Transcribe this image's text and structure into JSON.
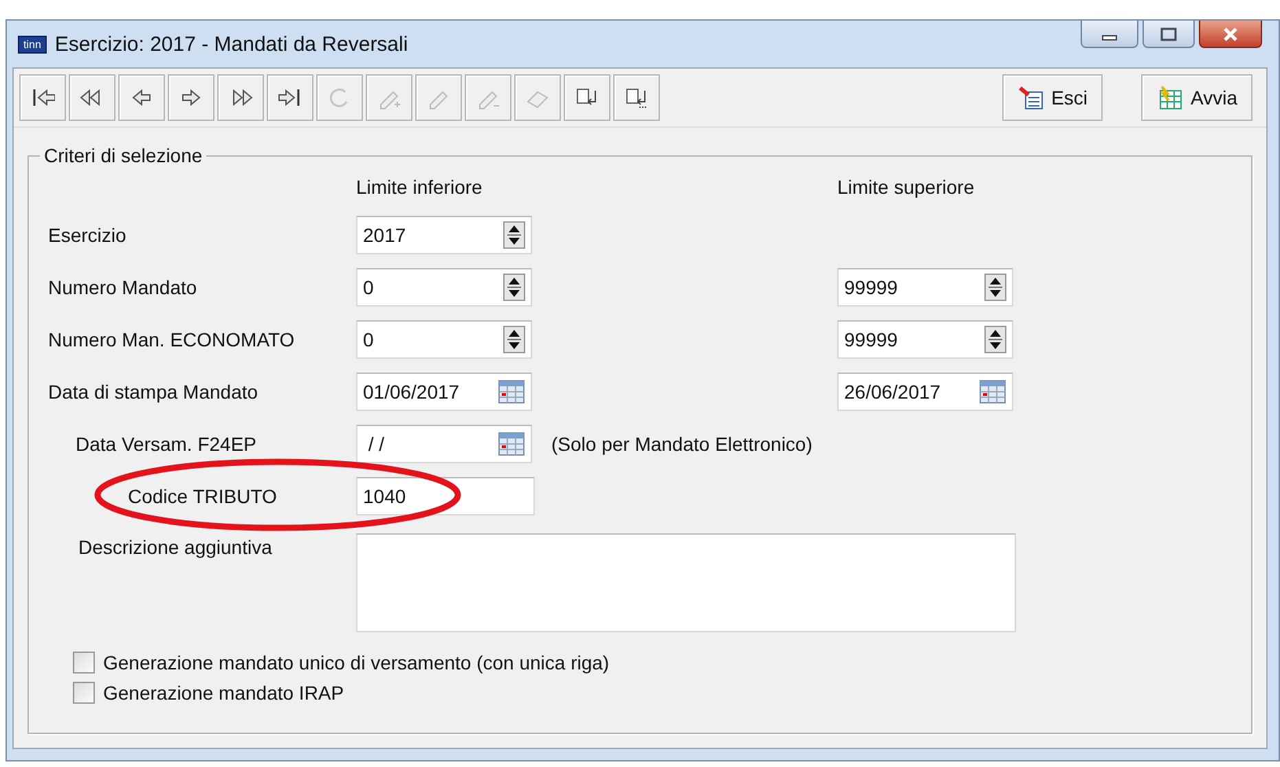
{
  "window": {
    "title": "Esercizio: 2017 - Mandati da Reversali",
    "app_badge": "tinn"
  },
  "toolbar": {
    "tools": [
      {
        "kind": "first",
        "disabled": false
      },
      {
        "kind": "prev-page",
        "disabled": false
      },
      {
        "kind": "prev",
        "disabled": false
      },
      {
        "kind": "next",
        "disabled": false
      },
      {
        "kind": "next-page",
        "disabled": false
      },
      {
        "kind": "last",
        "disabled": false
      },
      {
        "kind": "refresh",
        "disabled": true
      },
      {
        "kind": "edit-add",
        "disabled": true
      },
      {
        "kind": "edit",
        "disabled": true
      },
      {
        "kind": "edit-remove",
        "disabled": true
      },
      {
        "kind": "eraser",
        "disabled": true
      },
      {
        "kind": "find",
        "disabled": false
      },
      {
        "kind": "find-more",
        "disabled": false
      }
    ],
    "actions": [
      {
        "kind": "exit",
        "label": "Esci"
      },
      {
        "kind": "run",
        "label": "Avvia"
      }
    ]
  },
  "criteria": {
    "title": "Criteri di selezione",
    "column_headers": [
      "Limite inferiore",
      "Limite superiore"
    ],
    "rows": [
      {
        "kind": "range",
        "label": "Esercizio",
        "from": {
          "kind": "spin",
          "value": "2017"
        }
      },
      {
        "kind": "range",
        "label": "Numero Mandato",
        "from": {
          "kind": "spin",
          "value": "0"
        },
        "to": {
          "kind": "spin",
          "value": "99999"
        }
      },
      {
        "kind": "range",
        "label": "Numero Man. ECONOMATO",
        "from": {
          "kind": "spin",
          "value": "0"
        },
        "to": {
          "kind": "spin",
          "value": "99999"
        }
      },
      {
        "kind": "range",
        "label": "Data di stampa Mandato",
        "from": {
          "kind": "date",
          "value": "01/06/2017"
        },
        "to": {
          "kind": "date",
          "value": "26/06/2017"
        }
      },
      {
        "kind": "note",
        "label": "Data Versam. F24EP",
        "from": {
          "kind": "date",
          "value": " / /"
        },
        "note": "(Solo per Mandato Elettronico)"
      },
      {
        "kind": "code",
        "label": "Codice TRIBUTO",
        "from": {
          "kind": "text",
          "value": "1040"
        }
      },
      {
        "kind": "memo",
        "label": "Descrizione aggiuntiva",
        "from": {
          "kind": "memo"
        }
      }
    ],
    "options": [
      {
        "label": "Generazione mandato unico di versamento (con unica riga)",
        "checked": false
      },
      {
        "label": "Generazione mandato IRAP",
        "checked": false
      }
    ]
  },
  "annotation": {
    "kind": "ellipse"
  }
}
